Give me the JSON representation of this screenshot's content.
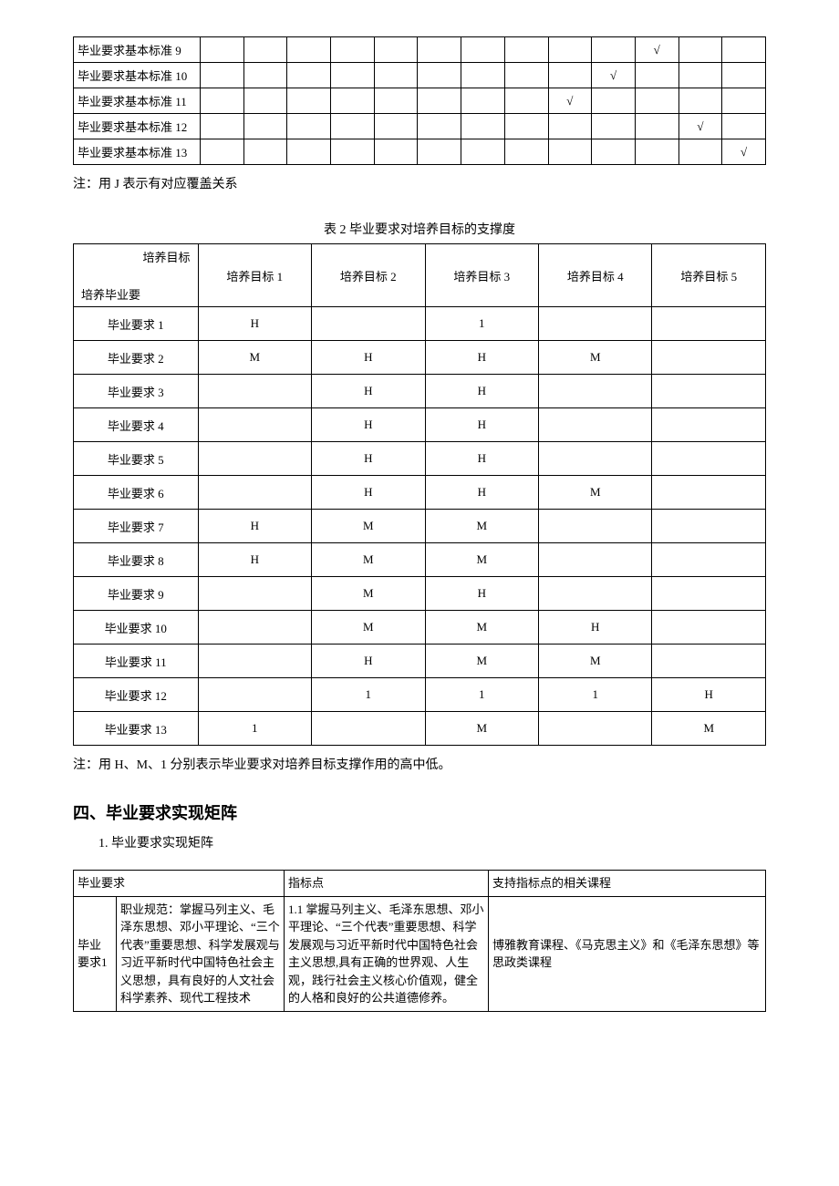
{
  "table1": {
    "rows": [
      {
        "label": "毕业要求基本标准 9",
        "marks": [
          "",
          "",
          "",
          "",
          "",
          "",
          "",
          "",
          "",
          "",
          "√",
          "",
          ""
        ]
      },
      {
        "label": "毕业要求基本标准 10",
        "marks": [
          "",
          "",
          "",
          "",
          "",
          "",
          "",
          "",
          "",
          "√",
          "",
          "",
          ""
        ]
      },
      {
        "label": "毕业要求基本标准 11",
        "marks": [
          "",
          "",
          "",
          "",
          "",
          "",
          "",
          "",
          "√",
          "",
          "",
          "",
          ""
        ]
      },
      {
        "label": "毕业要求基本标准 12",
        "marks": [
          "",
          "",
          "",
          "",
          "",
          "",
          "",
          "",
          "",
          "",
          "",
          "√",
          ""
        ]
      },
      {
        "label": "毕业要求基本标准 13",
        "marks": [
          "",
          "",
          "",
          "",
          "",
          "",
          "",
          "",
          "",
          "",
          "",
          "",
          "√"
        ]
      }
    ]
  },
  "note1": "注：用 J 表示有对应覆盖关系",
  "table2": {
    "caption": "表 2 毕业要求对培养目标的支撑度",
    "diag_top": "培养目标",
    "diag_bottom": "培养毕业要",
    "headers": [
      "培养目标 1",
      "培养目标 2",
      "培养目标 3",
      "培养目标 4",
      "培养目标 5"
    ],
    "rows": [
      {
        "label": "毕业要求 1",
        "vals": [
          "H",
          "",
          "1",
          "",
          ""
        ]
      },
      {
        "label": "毕业要求 2",
        "vals": [
          "M",
          "H",
          "H",
          "M",
          ""
        ]
      },
      {
        "label": "毕业要求 3",
        "vals": [
          "",
          "H",
          "H",
          "",
          ""
        ]
      },
      {
        "label": "毕业要求 4",
        "vals": [
          "",
          "H",
          "H",
          "",
          ""
        ]
      },
      {
        "label": "毕业要求 5",
        "vals": [
          "",
          "H",
          "H",
          "",
          ""
        ]
      },
      {
        "label": "毕业要求 6",
        "vals": [
          "",
          "H",
          "H",
          "M",
          ""
        ]
      },
      {
        "label": "毕业要求 7",
        "vals": [
          "H",
          "M",
          "M",
          "",
          ""
        ]
      },
      {
        "label": "毕业要求 8",
        "vals": [
          "H",
          "M",
          "M",
          "",
          ""
        ]
      },
      {
        "label": "毕业要求 9",
        "vals": [
          "",
          "M",
          "H",
          "",
          ""
        ]
      },
      {
        "label": "毕业要求 10",
        "vals": [
          "",
          "M",
          "M",
          "H",
          ""
        ]
      },
      {
        "label": "毕业要求 11",
        "vals": [
          "",
          "H",
          "M",
          "M",
          ""
        ]
      },
      {
        "label": "毕业要求 12",
        "vals": [
          "",
          "1",
          "1",
          "1",
          "H"
        ]
      },
      {
        "label": "毕业要求 13",
        "vals": [
          "1",
          "",
          "M",
          "",
          "M"
        ]
      }
    ]
  },
  "note2": "注：用 H、M、1 分别表示毕业要求对培养目标支撑作用的高中低。",
  "section4": {
    "title": "四、毕业要求实现矩阵",
    "sub": "1. 毕业要求实现矩阵"
  },
  "table3": {
    "headers": [
      "毕业要求",
      "指标点",
      "支持指标点的相关课程"
    ],
    "row": {
      "left_label": "毕业要求1",
      "desc": "职业规范：掌握马列主义、毛泽东思想、邓小平理论、“三个代表”重要思想、科学发展观与习近平新时代中国特色社会主义思想，具有良好的人文社会科学素养、现代工程技术",
      "indicator": "1.1 掌握马列主义、毛泽东思想、邓小平理论、“三个代表”重要思想、科学发展观与习近平新时代中国特色社会主义思想,具有正确的世界观、人生观，践行社会主义核心价值观，健全的人格和良好的公共道德修养。",
      "courses": "博雅教育课程、《马克思主义》和《毛泽东思想》等思政类课程"
    }
  }
}
